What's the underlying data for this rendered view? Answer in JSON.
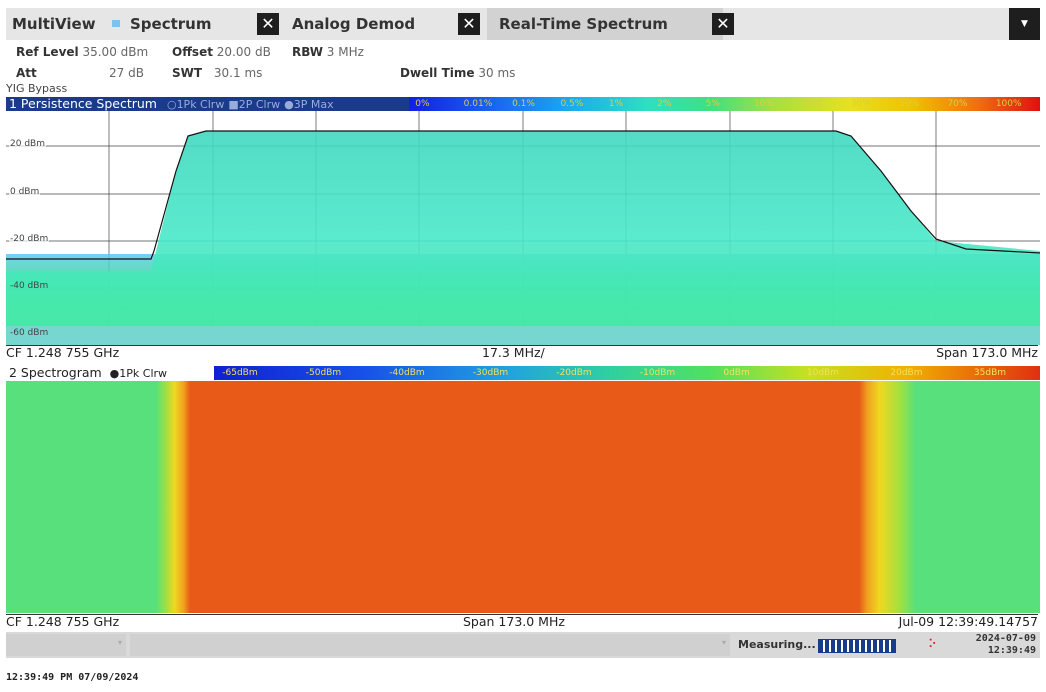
{
  "tabs": [
    {
      "label": "MultiView"
    },
    {
      "label": "Spectrum"
    },
    {
      "label": "Analog Demod"
    },
    {
      "label": "Real-Time Spectrum"
    }
  ],
  "settings": {
    "ref_level_label": "Ref Level",
    "ref_level_value": "35.00 dBm",
    "offset_label": "Offset",
    "offset_value": "20.00 dB",
    "rbw_label": "RBW",
    "rbw_value": "3 MHz",
    "att_label": "Att",
    "att_value": "27 dB",
    "swt_label": "SWT",
    "swt_value": "30.1 ms",
    "dwell_label": "Dwell Time",
    "dwell_value": "30 ms",
    "yig": "YIG Bypass"
  },
  "persistence": {
    "title": "1 Persistence Spectrum",
    "legend": [
      "1Pk Clrw",
      "2P Clrw",
      "3P Max"
    ],
    "scale": [
      "0%",
      "0.01%",
      "0.1%",
      "0.5%",
      "1%",
      "2%",
      "5%",
      "10%",
      "20%",
      "30%",
      "50%",
      "70%",
      "100%"
    ],
    "ylabels": [
      "20 dBm",
      "0 dBm",
      "-20 dBm",
      "-40 dBm",
      "-60 dBm"
    ],
    "footer_cf": "CF 1.248 755 GHz",
    "footer_div": "17.3 MHz/",
    "footer_span": "Span 173.0 MHz"
  },
  "spectrogram": {
    "title": "2 Spectrogram",
    "legend": "1Pk Clrw",
    "scale": [
      "-65dBm",
      "-50dBm",
      "-40dBm",
      "-30dBm",
      "-20dBm",
      "-10dBm",
      "0dBm",
      "10dBm",
      "20dBm",
      "35dBm"
    ],
    "footer_cf": "CF 1.248 755 GHz",
    "footer_span": "Span 173.0 MHz",
    "footer_time": "Jul-09 12:39:49.14757"
  },
  "status": {
    "measuring": "Measuring...",
    "date": "2024-07-09",
    "time": "12:39:49"
  },
  "clock": "12:39:49 PM  07/09/2024",
  "colors": {
    "title_bg": "#1a3a8c",
    "trace_bg": "#48e8c8",
    "spectrogram_center": "#e85a18"
  }
}
